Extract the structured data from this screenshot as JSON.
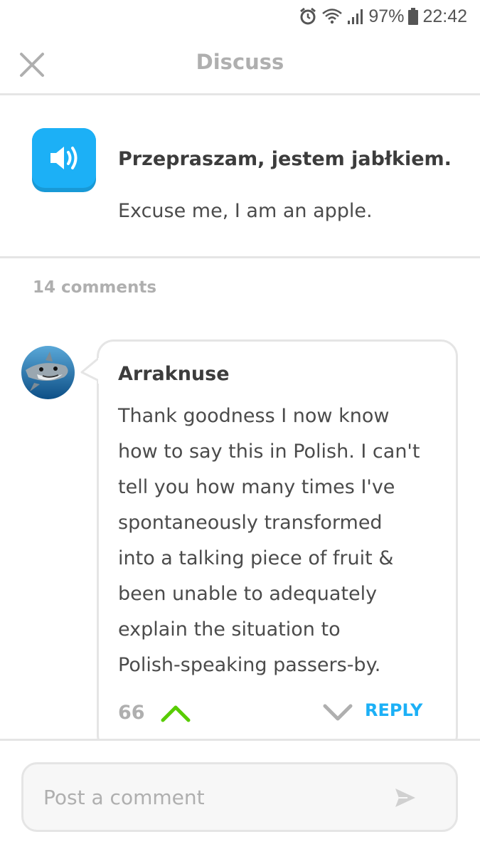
{
  "status_bar": {
    "battery": "97%",
    "time": "22:42",
    "icons": [
      "alarm-icon",
      "wifi-icon",
      "signal-icon",
      "battery-icon"
    ]
  },
  "header": {
    "title": "Discuss",
    "close_icon": "close-icon"
  },
  "sentence": {
    "audio_icon": "speaker-icon",
    "text": "Przepraszam, jestem jabłkiem.",
    "translation": "Excuse me, I am an apple."
  },
  "comments_count": "14 comments",
  "comment": {
    "username": "Arraknuse",
    "lines": [
      "Thank goodness I now know",
      "how to say this in Polish. I can't",
      "tell you how many times I've",
      "spontaneously transformed",
      "into a talking piece of fruit &",
      "been unable to adequately",
      "explain the situation to",
      "Polish-speaking passers-by."
    ],
    "score": "66",
    "reply_label": "REPLY"
  },
  "post": {
    "placeholder": "Post a comment"
  },
  "colors": {
    "accent_blue": "#1cb0f6",
    "upvote_green": "#58cc02",
    "muted_gray": "#afafaf",
    "border_gray": "#e5e5e5"
  }
}
